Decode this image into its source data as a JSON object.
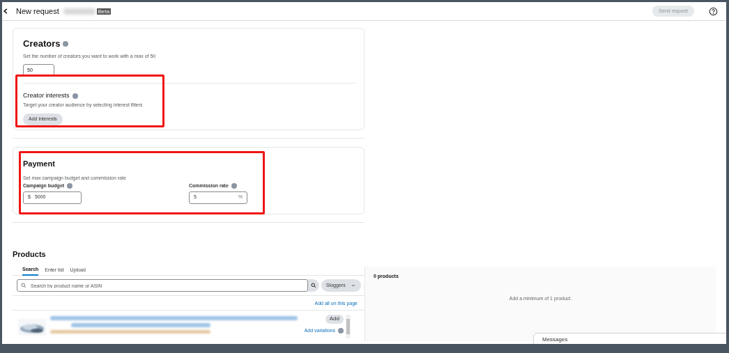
{
  "header": {
    "title": "New request",
    "badge": "Beta",
    "send_button": {
      "label": "Send request",
      "disabled": true
    }
  },
  "creators": {
    "title": "Creators",
    "description": "Set the number of creators you want to work with a max of 50",
    "value": "50",
    "interests": {
      "title": "Creator interests",
      "description": "Target your creator audience by selecting interest filters",
      "button": "Add interests"
    }
  },
  "payment": {
    "title": "Payment",
    "description": "Set max campaign budget and commission rate",
    "fields": [
      {
        "label": "Campaign budget",
        "prefix": "$",
        "value": "5000"
      },
      {
        "label": "Commission rate",
        "suffix": "%",
        "value": "5"
      }
    ]
  },
  "products": {
    "title": "Products",
    "tabs": [
      {
        "label": "Search",
        "selected": true
      },
      {
        "label": "Enter list",
        "selected": false
      },
      {
        "label": "Upload",
        "selected": false
      }
    ],
    "search": {
      "placeholder": "Search by product name or ASIN"
    },
    "brand_filter": "Sloggers",
    "add_all": "Add all on this page",
    "results": [
      {
        "add": "Add",
        "add_variations": "Add variations"
      }
    ],
    "selected_panel": {
      "count": "0 products",
      "empty_message": "Add a minimum of 1 product."
    }
  },
  "messages": {
    "title": "Messages"
  }
}
